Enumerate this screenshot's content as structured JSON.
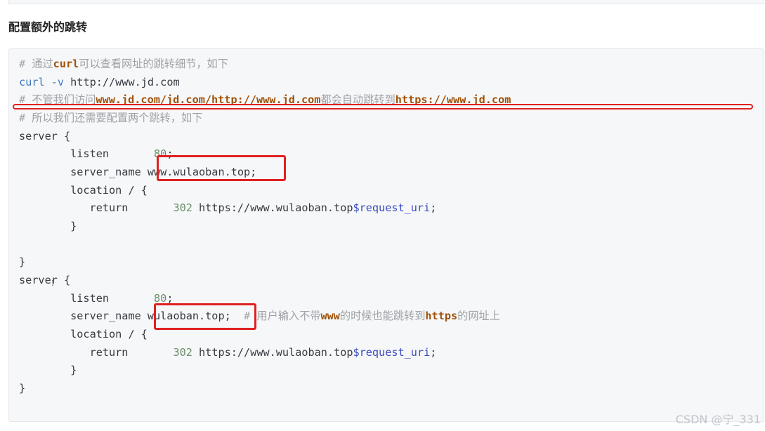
{
  "heading": "配置额外的跳转",
  "lines": {
    "l1": {
      "hash": "# ",
      "a": "通过",
      "b": "curl",
      "c": "可以查看网址的跳转细节，如下"
    },
    "l2": {
      "a": "curl -v",
      "b": " http://www.jd.com"
    },
    "l3": {
      "hash": "# ",
      "a": "不管我们访问",
      "b": "www.jd.com/jd.com/http://www.jd.com",
      "c": "都会自动跳转到",
      "d": "https://www.jd.com"
    },
    "l4": {
      "hash": "# ",
      "a": "所以我们还需要配置两个跳转，如下"
    },
    "l5": "server {",
    "l6": {
      "key": "        listen       ",
      "num": "80",
      "end": ";"
    },
    "l7": {
      "key": "        server_name ",
      "val": "www.wulaoban.top;"
    },
    "l8": "        location / {",
    "l9": {
      "key": "           return       ",
      "num": "302",
      "url": " https://www.wulaoban.top",
      "var": "$request_uri",
      "end": ";"
    },
    "l10": "        }",
    "l12": "}",
    "l13": "server {",
    "l14": {
      "key": "        listen       ",
      "num": "80",
      "end": ";"
    },
    "l15": {
      "key": "        server_name ",
      "val": "wulaoban.top;",
      "sp": "  ",
      "hash": "# ",
      "a": "用户输入不带",
      "b": "www",
      "c": "的时候也能跳转到",
      "d": "https",
      "e": "的网址上"
    },
    "l16": "        location / {",
    "l17": {
      "key": "           return       ",
      "num": "302",
      "url": " https://www.wulaoban.top",
      "var": "$request_uri",
      "end": ";"
    },
    "l18": "        }",
    "l19": "}"
  },
  "watermark": "CSDN @宁_331",
  "colors": {
    "highlight": "#e02020",
    "comment": "#a0a1a7",
    "keyword": "#4078c0",
    "variable": "#3b4cc0"
  }
}
